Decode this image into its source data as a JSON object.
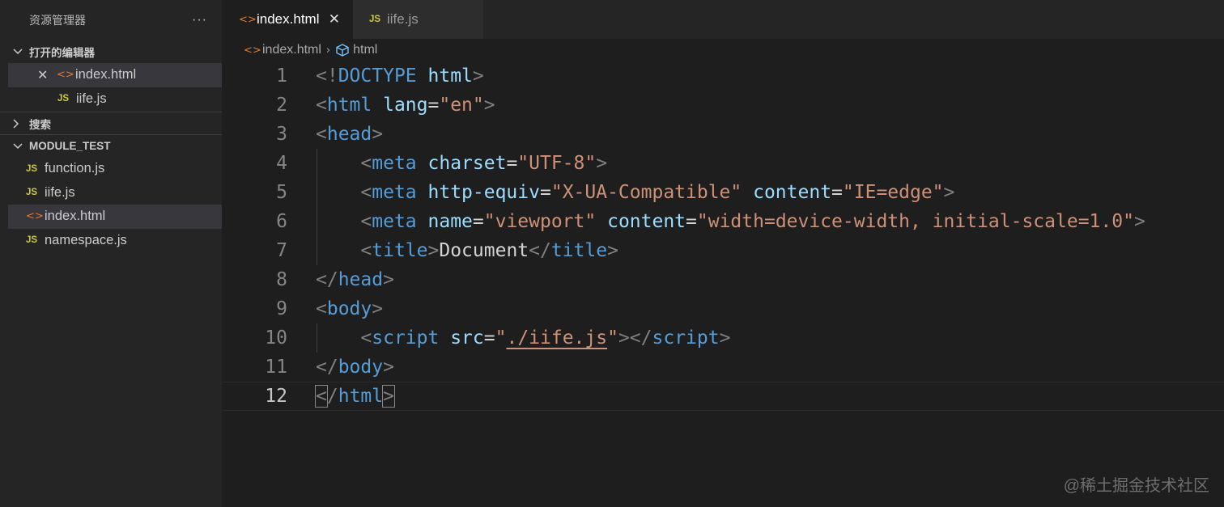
{
  "sidebar": {
    "title": "资源管理器",
    "more": "···",
    "open_editors": {
      "header": "打开的编辑器",
      "items": [
        {
          "name": "index.html",
          "icon": "html-icon",
          "close": "✕"
        },
        {
          "name": "iife.js",
          "icon": "js-icon"
        }
      ]
    },
    "search_header": "搜索",
    "project": {
      "header": "MODULE_TEST",
      "files": [
        {
          "name": "function.js",
          "icon": "js-icon"
        },
        {
          "name": "iife.js",
          "icon": "js-icon"
        },
        {
          "name": "index.html",
          "icon": "html-icon"
        },
        {
          "name": "namespace.js",
          "icon": "js-icon"
        }
      ]
    }
  },
  "icons": {
    "js": "JS",
    "html": "<>",
    "chevron_down": "∨",
    "chevron_right": "›",
    "close": "✕"
  },
  "tabs": [
    {
      "label": "index.html",
      "active": true
    },
    {
      "label": "iife.js",
      "active": false
    }
  ],
  "breadcrumb": {
    "file": "index.html",
    "symbol": "html"
  },
  "code": {
    "line_numbers": [
      "1",
      "2",
      "3",
      "4",
      "5",
      "6",
      "7",
      "8",
      "9",
      "10",
      "11",
      "12"
    ],
    "current_line": 12
  },
  "watermark": "@稀土掘金技术社区",
  "colors": {
    "tag": "#569cd6",
    "attr": "#9cdcfe",
    "string": "#ce9178",
    "punct": "#808080",
    "js_icon": "#cbcb41",
    "html_icon": "#e37933"
  }
}
